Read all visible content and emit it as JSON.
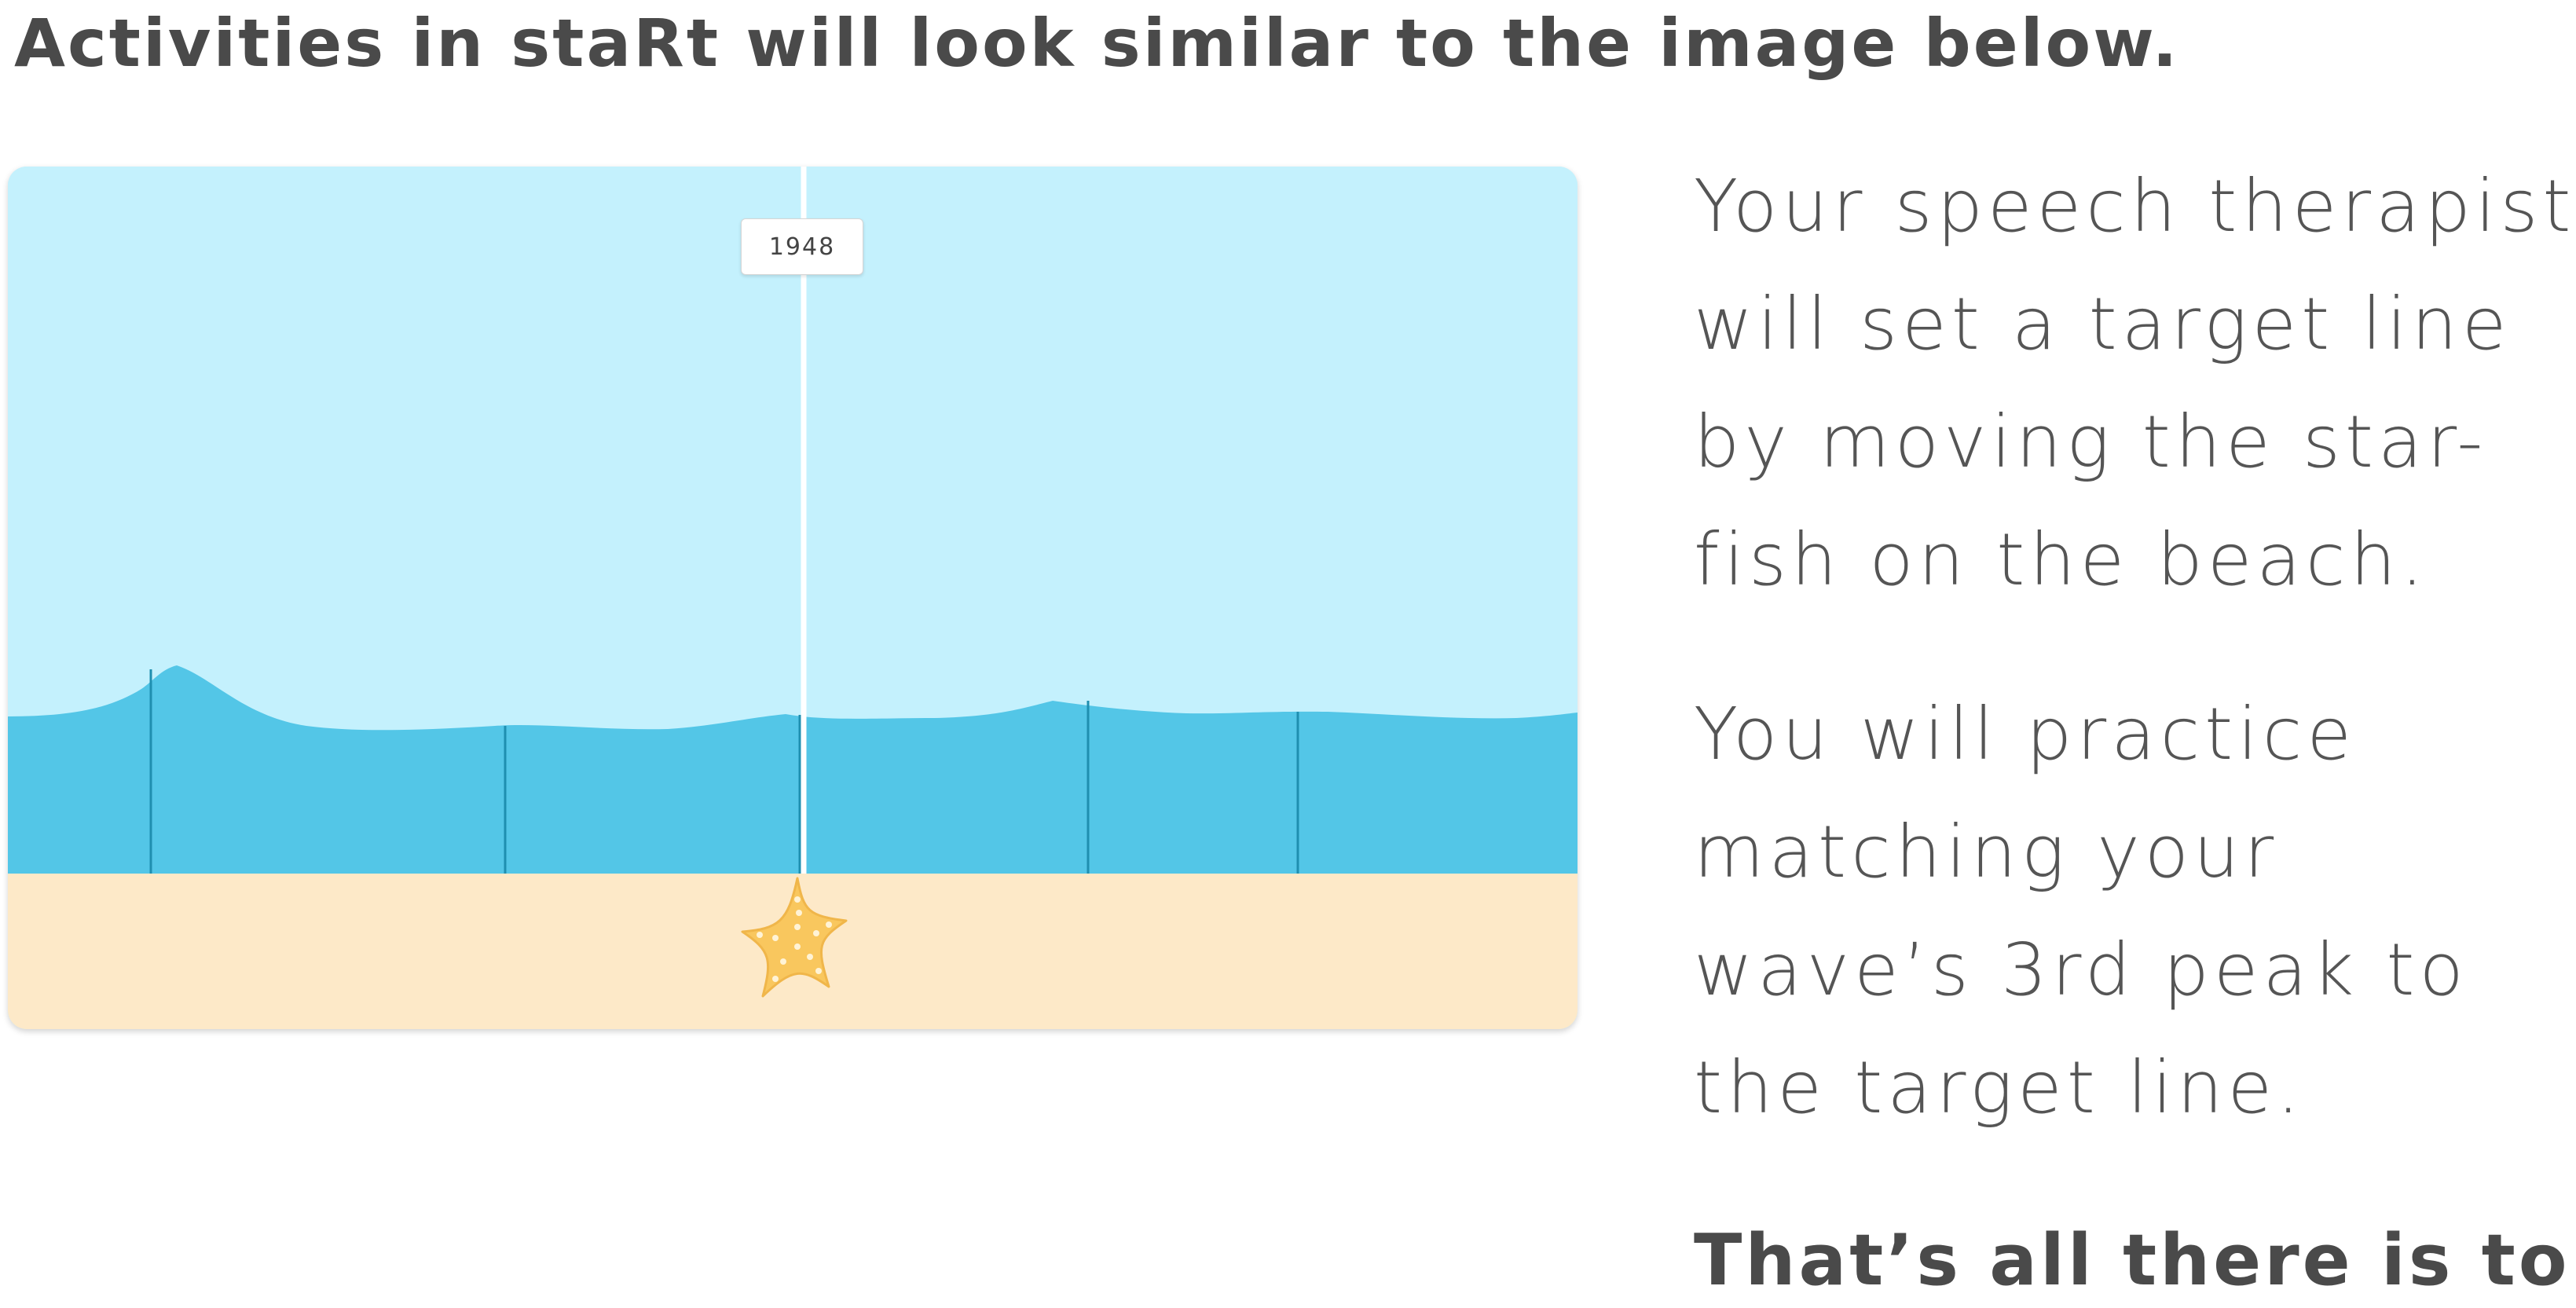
{
  "heading": "Activities in staRt will look similar to the image below.",
  "scene": {
    "target_value": "1948",
    "colors": {
      "sky": "#c4f1fd",
      "water": "#53c6e7",
      "peak_lines": "#1f8fb0",
      "sand": "#fde9c8",
      "target_line": "#ffffff",
      "starfish": "#f9c75e",
      "starfish_dots": "#fff3d6"
    },
    "icons": {
      "starfish": "starfish-icon"
    }
  },
  "instructions": {
    "paragraph1": [
      "Your speech therapist",
      "will set a target line",
      "by moving the star-",
      "fish on the beach."
    ],
    "paragraph2": [
      "You will practice",
      "matching  your",
      "wave’s 3rd peak to",
      "the target line."
    ],
    "closing": "That’s all there is to it."
  }
}
